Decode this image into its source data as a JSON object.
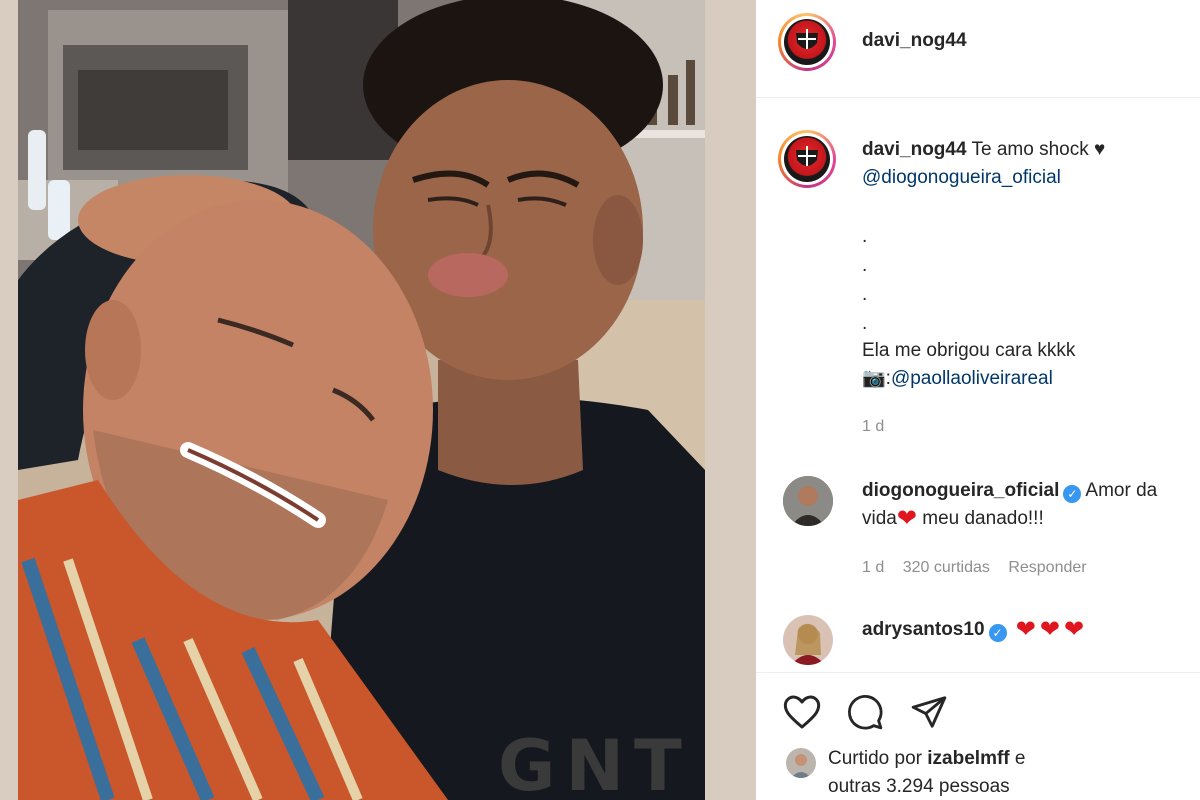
{
  "post": {
    "author": "davi_nog44",
    "caption_username": "davi_nog44",
    "caption_text": "Te amo shock ♥",
    "caption_mention": "@diogonogueira_oficial",
    "dots": [
      ".",
      ".",
      ".",
      "."
    ],
    "caption_line2": "Ela me obrigou cara kkkk",
    "camera_emoji": "📷",
    "photo_credit_prefix": ":",
    "photo_credit_mention": "@paollaoliveirareal",
    "caption_time": "1 d"
  },
  "comments": [
    {
      "username": "diogonogueira_oficial",
      "verified": true,
      "text_part1": "Amor da",
      "text_part2_prefix": "vida",
      "text_part2_suffix": "meu danado!!!",
      "time": "1 d",
      "likes": "320 curtidas",
      "reply_label": "Responder"
    },
    {
      "username": "adrysantos10",
      "verified": true,
      "hearts": "❤❤❤"
    }
  ],
  "likes": {
    "prefix": "Curtido por",
    "user": "izabelmff",
    "connector": "e",
    "others": "outras 3.294 pessoas"
  },
  "photo_text": "GNT",
  "icons": {
    "like": "heart-outline-icon",
    "comment": "comment-bubble-icon",
    "share": "paper-plane-icon",
    "verified": "verified-badge-icon",
    "camera": "camera-emoji"
  },
  "colors": {
    "mention": "#00376b",
    "verified": "#3897f0",
    "heart": "#e0161e",
    "meta": "#8e8e8e"
  }
}
